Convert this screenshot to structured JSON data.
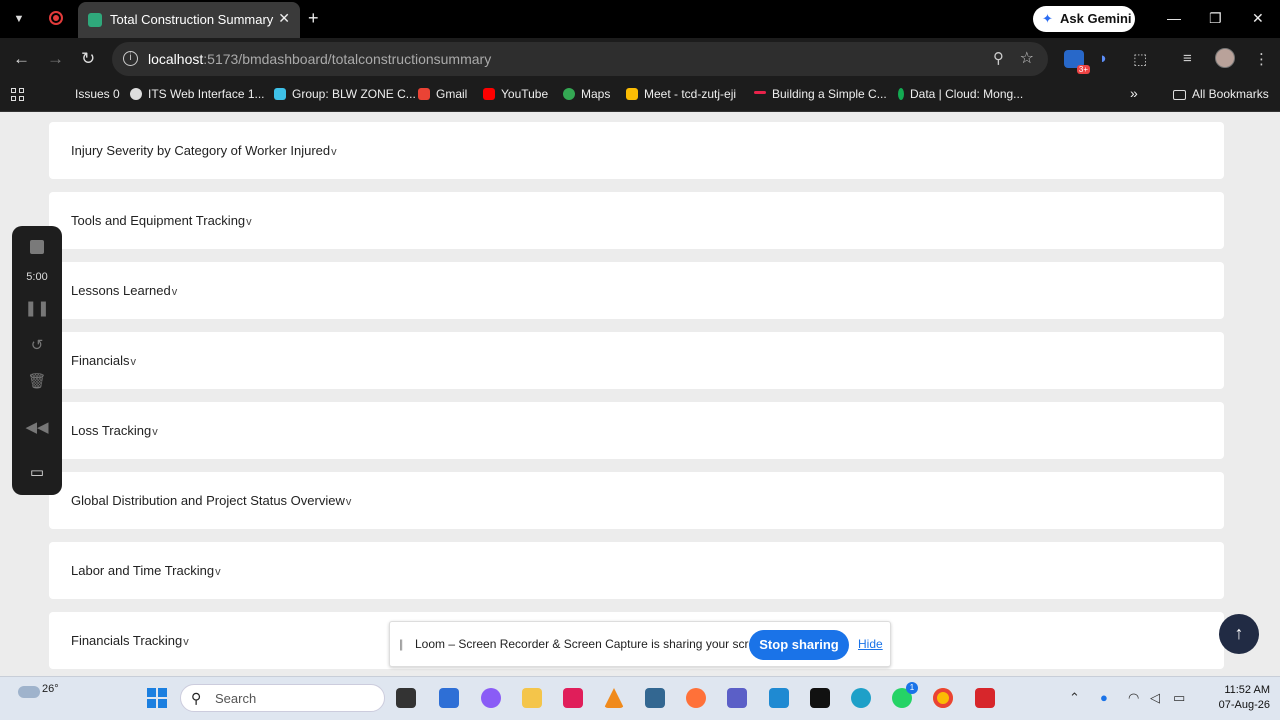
{
  "browser": {
    "tab_title": "Total Construction Summary",
    "gemini_label": "Ask Gemini",
    "url_host": "localhost",
    "url_path": ":5173/bmdashboard/totalconstructionsummary"
  },
  "bookmarks": [
    {
      "label": "Issues 0",
      "color": "#1c1c1c"
    },
    {
      "label": "ITS Web Interface 1...",
      "color": "#dddddd"
    },
    {
      "label": "Group: BLW ZONE C...",
      "color": "#3ec1e8"
    },
    {
      "label": "Gmail",
      "color": "#ea4335"
    },
    {
      "label": "YouTube",
      "color": "#ff0000"
    },
    {
      "label": "Maps",
      "color": "#34a853"
    },
    {
      "label": "Meet - tcd-zutj-eji",
      "color": "#fbbc04"
    },
    {
      "label": "Building a Simple C...",
      "color": "#e8224a"
    },
    {
      "label": "Data | Cloud: Mong...",
      "color": "#13aa52"
    }
  ],
  "all_bookmarks_label": "All Bookmarks",
  "sections": [
    {
      "label": "Injury Severity by Category of Worker Injured"
    },
    {
      "label": "Tools and Equipment Tracking"
    },
    {
      "label": "Lessons Learned"
    },
    {
      "label": "Financials"
    },
    {
      "label": "Loss Tracking"
    },
    {
      "label": "Global Distribution and Project Status Overview"
    },
    {
      "label": "Labor and Time Tracking"
    },
    {
      "label": "Financials Tracking"
    }
  ],
  "recorder": {
    "time": "5:00"
  },
  "share_bar": {
    "message": "Loom – Screen Recorder & Screen Capture is sharing your screen.",
    "stop_label": "Stop sharing",
    "hide_label": "Hide"
  },
  "taskbar": {
    "temperature": "26°",
    "search_placeholder": "Search",
    "time": "11:52 AM",
    "date": "07-Aug-26",
    "whatsapp_badge": "1"
  }
}
